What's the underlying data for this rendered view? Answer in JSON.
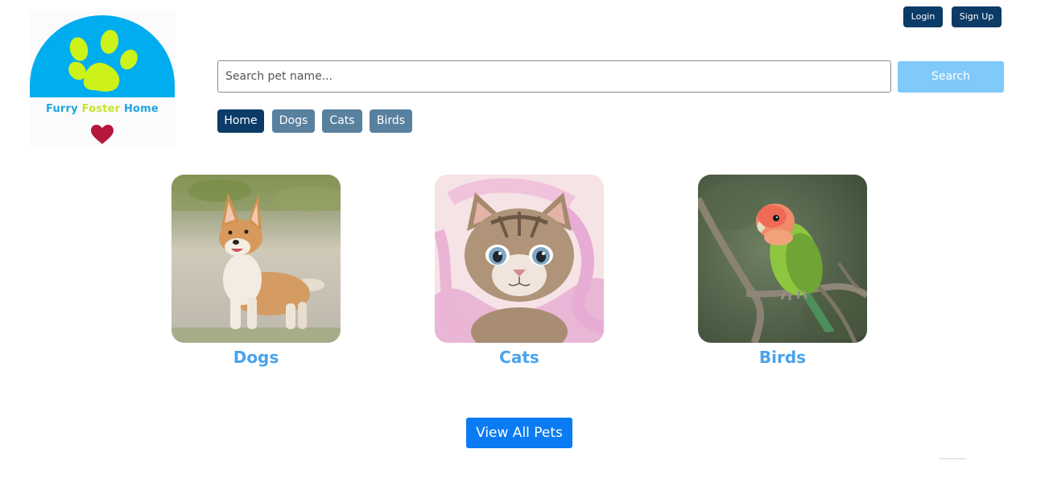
{
  "header": {
    "logo": {
      "word1": "Furry",
      "word2": "Foster",
      "word3": "Home",
      "paw_icon": "paw-icon",
      "heart_icon": "heart-icon"
    },
    "login_label": "Login",
    "signup_label": "Sign Up"
  },
  "search": {
    "placeholder": "Search pet name...",
    "value": "",
    "button_label": "Search"
  },
  "nav": {
    "items": [
      {
        "label": "Home",
        "active": true
      },
      {
        "label": "Dogs",
        "active": false
      },
      {
        "label": "Cats",
        "active": false
      },
      {
        "label": "Birds",
        "active": false
      }
    ]
  },
  "categories": [
    {
      "label": "Dogs",
      "image": "corgi-photo"
    },
    {
      "label": "Cats",
      "image": "kitten-photo"
    },
    {
      "label": "Birds",
      "image": "lovebird-photo"
    }
  ],
  "view_all_label": "View All Pets",
  "colors": {
    "primary_dark": "#0b3b66",
    "nav_inactive": "#58809f",
    "search_button": "#7fc9fb",
    "category_label": "#4aa3ec",
    "view_all": "#0a7bf2",
    "logo_blue": "#00adef",
    "logo_green": "#c6e52a",
    "heart_red": "#b5183b"
  }
}
